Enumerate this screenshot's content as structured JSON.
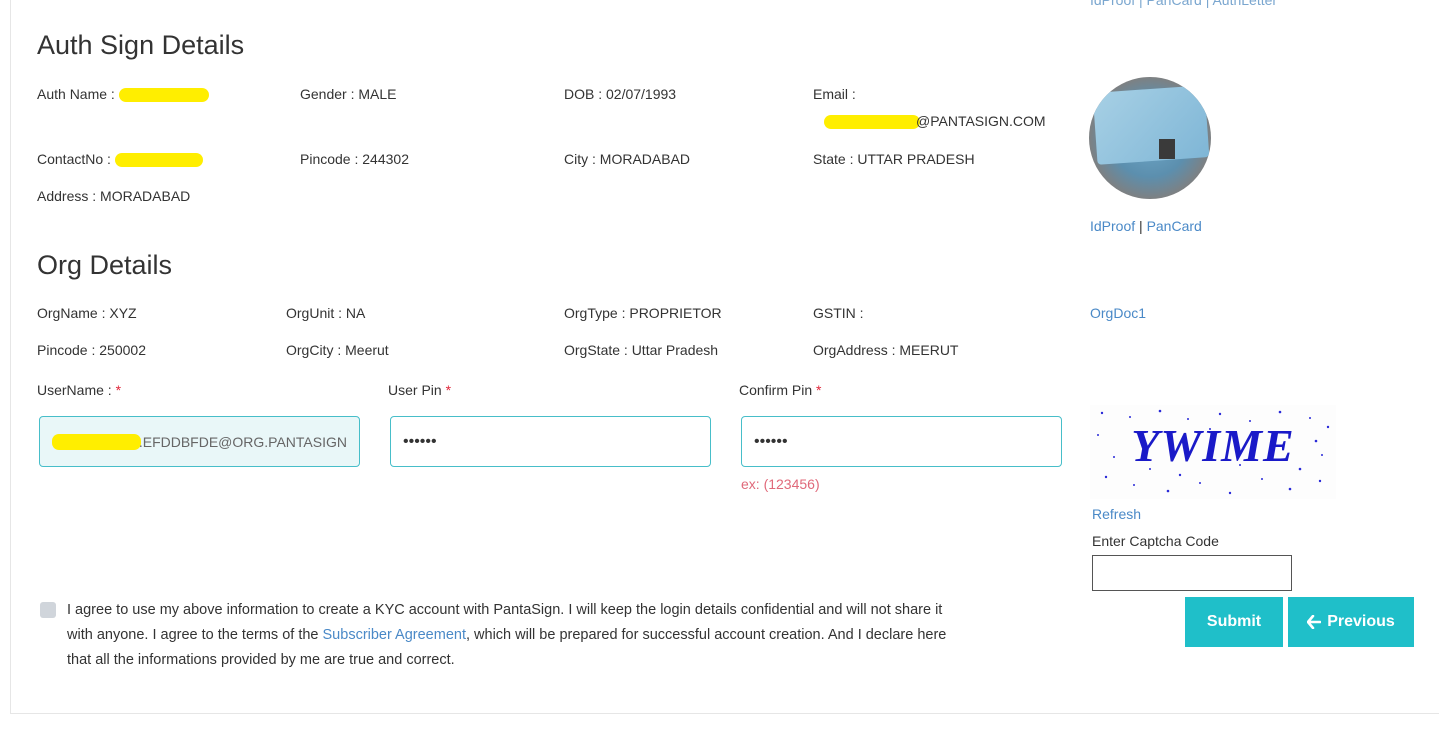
{
  "auth": {
    "title": "Auth Sign Details",
    "name_label": "Auth Name :",
    "gender": "Gender : MALE",
    "dob": "DOB : 02/07/1993",
    "email_label": "Email :",
    "email_value": "@PANTASIGN.COM",
    "contact_label": "ContactNo :",
    "pincode": "Pincode : 244302",
    "city": "City : MORADABAD",
    "state": "State : UTTAR PRADESH",
    "address": "Address : MORADABAD",
    "top_links": "IdProof | PanCard | AuthLetter",
    "idproof_link": "IdProof",
    "sep": "|",
    "pancard_link": "PanCard"
  },
  "org": {
    "title": "Org Details",
    "name": "OrgName : XYZ",
    "unit": "OrgUnit : NA",
    "type": "OrgType : PROPRIETOR",
    "gstin": "GSTIN :",
    "doc_link": "OrgDoc1",
    "pincode": "Pincode : 250002",
    "city": "OrgCity : Meerut",
    "state": "OrgState : Uttar Pradesh",
    "address": "OrgAddress : MEERUT"
  },
  "form": {
    "username_label": "UserName :",
    "userpin_label": "User Pin",
    "confirmpin_label": "Confirm Pin",
    "required_mark": "*",
    "username_value": ".EFDDBFDE@ORG.PANTASIGN",
    "userpin_value": "••••••",
    "confirmpin_value": "••••••",
    "pin_hint": "ex: (123456)"
  },
  "captcha": {
    "text": "YWIME",
    "refresh_label": "Refresh",
    "enter_label": "Enter Captcha Code",
    "value": ""
  },
  "agreement": {
    "part1": "I agree to use my above information to create a KYC account with PantaSign. I will keep the login details confidential and will not share it with anyone. I agree to the terms of the ",
    "link": "Subscriber Agreement",
    "part2": ", which will be prepared for successful account creation. And I declare here that all the informations provided by me are true and correct."
  },
  "buttons": {
    "submit": "Submit",
    "previous": "Previous"
  },
  "colors": {
    "accent": "#1fbfc9",
    "link": "#4a89c7",
    "required": "#e0263a"
  }
}
